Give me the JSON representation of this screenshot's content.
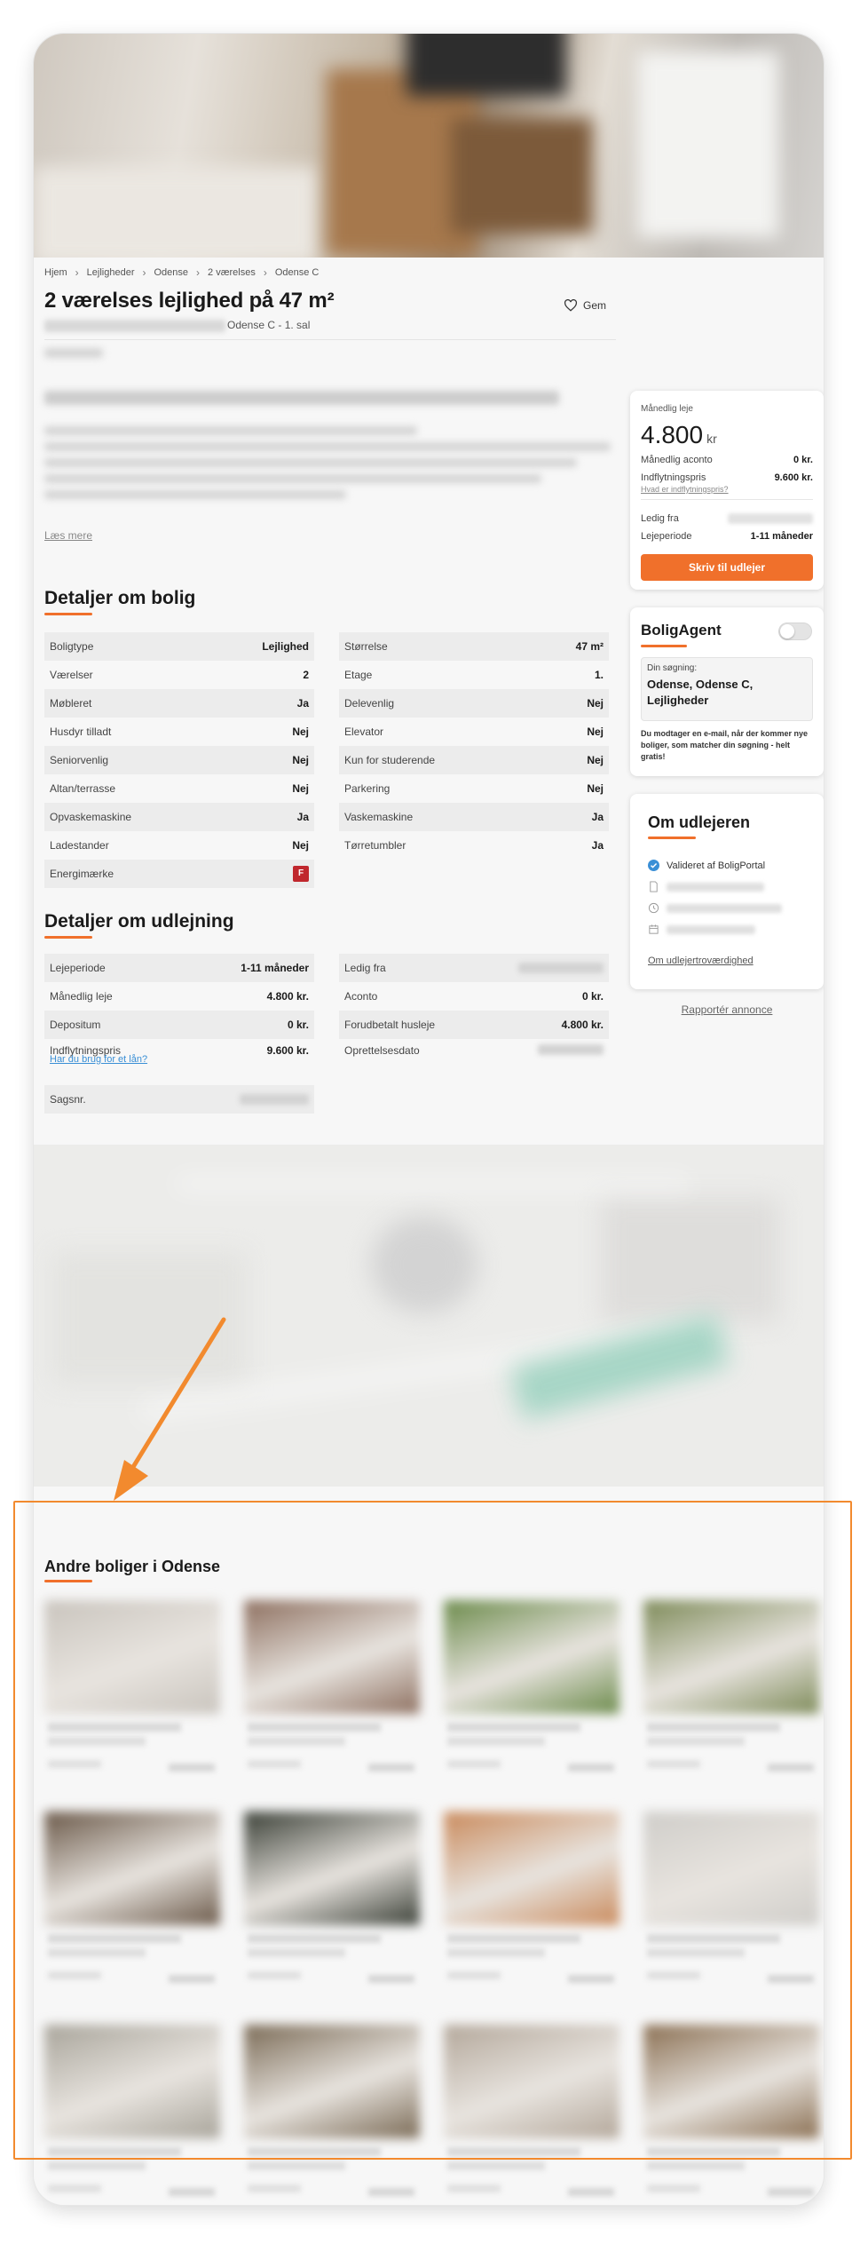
{
  "breadcrumb": [
    "Hjem",
    "Lejligheder",
    "Odense",
    "2 værelses",
    "Odense C"
  ],
  "listing": {
    "title": "2 værelses lejlighed på 47 m²",
    "address_suffix": "Odense C - 1. sal",
    "save_label": "Gem",
    "read_more": "Læs mere"
  },
  "details": {
    "title": "Detaljer om bolig",
    "left": [
      {
        "label": "Boligtype",
        "value": "Lejlighed"
      },
      {
        "label": "Værelser",
        "value": "2"
      },
      {
        "label": "Møbleret",
        "value": "Ja"
      },
      {
        "label": "Husdyr tilladt",
        "value": "Nej"
      },
      {
        "label": "Seniorvenlig",
        "value": "Nej"
      },
      {
        "label": "Altan/terrasse",
        "value": "Nej"
      },
      {
        "label": "Opvaskemaskine",
        "value": "Ja"
      },
      {
        "label": "Ladestander",
        "value": "Nej"
      },
      {
        "label": "Energimærke",
        "value": "F"
      }
    ],
    "right": [
      {
        "label": "Størrelse",
        "value": "47 m²"
      },
      {
        "label": "Etage",
        "value": "1."
      },
      {
        "label": "Delevenlig",
        "value": "Nej"
      },
      {
        "label": "Elevator",
        "value": "Nej"
      },
      {
        "label": "Kun for studerende",
        "value": "Nej"
      },
      {
        "label": "Parkering",
        "value": "Nej"
      },
      {
        "label": "Vaskemaskine",
        "value": "Ja"
      },
      {
        "label": "Tørretumbler",
        "value": "Ja"
      }
    ]
  },
  "rental": {
    "title": "Detaljer om udlejning",
    "left": [
      {
        "label": "Lejeperiode",
        "value": "1-11 måneder"
      },
      {
        "label": "Månedlig leje",
        "value": "4.800 kr."
      },
      {
        "label": "Depositum",
        "value": "0 kr."
      },
      {
        "label": "Indflytningspris",
        "value": "9.600 kr."
      },
      {
        "label": "Sagsnr.",
        "value": ""
      }
    ],
    "right": [
      {
        "label": "Ledig fra",
        "value": ""
      },
      {
        "label": "Aconto",
        "value": "0 kr."
      },
      {
        "label": "Forudbetalt husleje",
        "value": "4.800 kr."
      },
      {
        "label": "Oprettelsesdato",
        "value": ""
      }
    ],
    "loan_link": "Har du brug for et lån?"
  },
  "sidebar": {
    "price": {
      "label": "Månedlig leje",
      "amount": "4.800",
      "unit": "kr",
      "aconto_label": "Månedlig aconto",
      "aconto_value": "0 kr.",
      "movein_label": "Indflytningspris",
      "movein_value": "9.600 kr.",
      "movein_help": "Hvad er indflytningspris?",
      "available_label": "Ledig fra",
      "period_label": "Lejeperiode",
      "period_value": "1-11 måneder",
      "contact_button": "Skriv til udlejer"
    },
    "agent": {
      "title": "BoligAgent",
      "search_label": "Din søgning:",
      "search_value": "Odense, Odense C, Lejligheder",
      "note": "Du modtager en e-mail, når der kommer nye boliger, som matcher din søgning - helt gratis!"
    },
    "landlord": {
      "title": "Om udlejeren",
      "verified": "Valideret af BoligPortal",
      "trust_link": "Om udlejertroværdighed"
    },
    "report_link": "Rapportér annonce"
  },
  "others": {
    "title": "Andre boliger i Odense",
    "card_colors": [
      "#c9c4bd",
      "#8d6f5f",
      "#6b8a4a",
      "#7d8a58",
      "#6a5848",
      "#3a3f36",
      "#c98a5c",
      "#cfcdc9",
      "#a8a49a",
      "#7a6a55",
      "#b3a79a",
      "#8a6f52"
    ]
  },
  "colors": {
    "accent": "#f0702b",
    "link": "#3a8fd6",
    "highlight": "#f28a2e",
    "energy_badge": "#c0272d"
  }
}
